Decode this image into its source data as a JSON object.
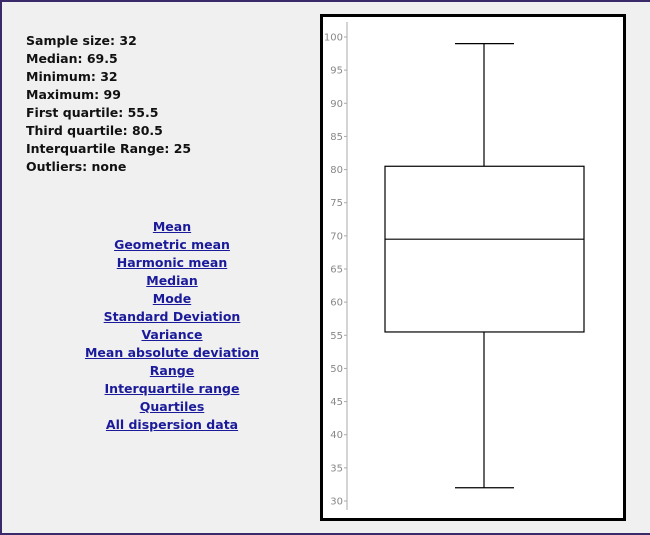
{
  "stats": [
    {
      "label": "Sample size",
      "value": "32"
    },
    {
      "label": "Median",
      "value": "69.5"
    },
    {
      "label": "Minimum",
      "value": "32"
    },
    {
      "label": "Maximum",
      "value": "99"
    },
    {
      "label": "First quartile",
      "value": "55.5"
    },
    {
      "label": "Third quartile",
      "value": "80.5"
    },
    {
      "label": "Interquartile Range",
      "value": "25"
    },
    {
      "label": "Outliers",
      "value": "none"
    }
  ],
  "links": [
    "Mean",
    "Geometric mean",
    "Harmonic mean",
    "Median",
    "Mode",
    "Standard Deviation",
    "Variance",
    "Mean absolute deviation",
    "Range",
    "Interquartile range",
    "Quartiles",
    "All dispersion data"
  ],
  "chart_data": {
    "type": "boxplot",
    "title": "",
    "xlabel": "",
    "ylabel": "",
    "ylim": [
      30,
      100
    ],
    "yticks": [
      30,
      35,
      40,
      45,
      50,
      55,
      60,
      65,
      70,
      75,
      80,
      85,
      90,
      95,
      100
    ],
    "grid": false,
    "series": [
      {
        "name": "",
        "min": 32,
        "q1": 55.5,
        "median": 69.5,
        "q3": 80.5,
        "max": 99,
        "outliers": []
      }
    ]
  }
}
